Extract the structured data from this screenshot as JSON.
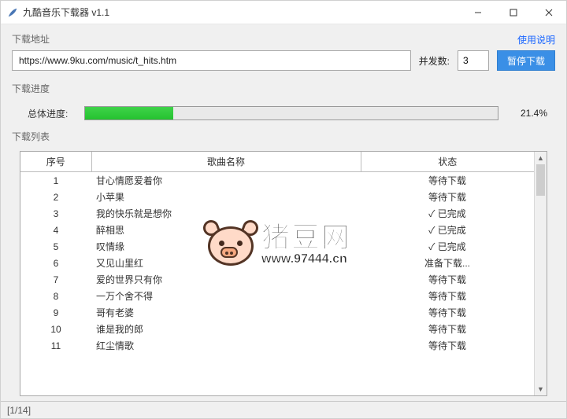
{
  "window": {
    "title": "九酷音乐下载器 v1.1"
  },
  "labels": {
    "download_url_section": "下载地址",
    "help_link": "使用说明",
    "concurrency": "并发数:",
    "pause_button": "暂停下载",
    "progress_section": "下载进度",
    "overall_progress": "总体进度:",
    "list_section": "下载列表",
    "col_index": "序号",
    "col_name": "歌曲名称",
    "col_status": "状态"
  },
  "form": {
    "url_value": "https://www.9ku.com/music/t_hits.htm",
    "concurrency_value": "3"
  },
  "progress": {
    "percent_text": "21.4%",
    "percent_value": 21.4
  },
  "table": {
    "rows": [
      {
        "index": "1",
        "name": "甘心情愿爱着你",
        "status": "等待下载"
      },
      {
        "index": "2",
        "name": "小苹果",
        "status": "等待下载"
      },
      {
        "index": "3",
        "name": "我的快乐就是想你",
        "status": "✓ 已完成"
      },
      {
        "index": "4",
        "name": "醉相思",
        "status": "✓ 已完成"
      },
      {
        "index": "5",
        "name": "叹情缘",
        "status": "✓ 已完成"
      },
      {
        "index": "6",
        "name": "又见山里红",
        "status": "准备下载..."
      },
      {
        "index": "7",
        "name": "爱的世界只有你",
        "status": "等待下载"
      },
      {
        "index": "8",
        "name": "一万个舍不得",
        "status": "等待下载"
      },
      {
        "index": "9",
        "name": "哥有老婆",
        "status": "等待下载"
      },
      {
        "index": "10",
        "name": "谁是我的郎",
        "status": "等待下载"
      },
      {
        "index": "11",
        "name": "红尘情歌",
        "status": "等待下载"
      }
    ]
  },
  "statusbar": {
    "text": "[1/14]"
  },
  "watermark": {
    "line1": "猪豆网",
    "line2": "www.97444.cn"
  }
}
